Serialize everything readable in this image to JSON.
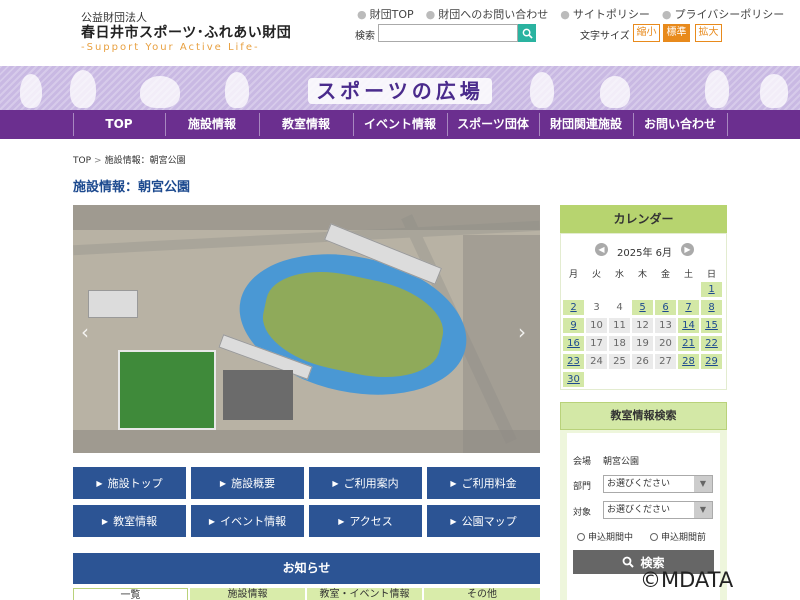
{
  "header": {
    "org_small": "公益財団法人",
    "org_name": "春日井市スポーツ･ふれあい財団",
    "tagline": "-Support Your Active Life-",
    "top_links": [
      "財団TOP",
      "財団へのお問い合わせ",
      "サイトポリシー",
      "プライバシーポリシー"
    ],
    "search_label": "検索",
    "search_value": "",
    "font_size_label": "文字サイズ",
    "font_sizes": [
      "縮小",
      "標準",
      "拡大"
    ],
    "active_font_size": "標準"
  },
  "banner": {
    "title": "スポーツの広場"
  },
  "nav": {
    "items": [
      "TOP",
      "施設情報",
      "教室情報",
      "イベント情報",
      "スポーツ団体",
      "財団関連施設",
      "お問い合わせ"
    ]
  },
  "breadcrumb": {
    "items": [
      "TOP",
      "施設情報：朝宮公園"
    ]
  },
  "page_title": "施設情報：朝宮公園",
  "carousel": {
    "prev": "‹",
    "next": "›"
  },
  "buttons": [
    "施設トップ",
    "施設概要",
    "ご利用案内",
    "ご利用料金",
    "教室情報",
    "イベント情報",
    "アクセス",
    "公園マップ"
  ],
  "news": {
    "title": "お知らせ",
    "tabs": [
      "一覧",
      "施設情報",
      "教室・イベント情報",
      "その他"
    ]
  },
  "calendar": {
    "title": "カレンダー",
    "month_label": "2025年 6月",
    "weekdays": [
      "月",
      "火",
      "水",
      "木",
      "金",
      "土",
      "日"
    ],
    "weeks": [
      [
        "",
        "",
        "",
        "",
        "",
        "",
        "1"
      ],
      [
        "2",
        "3",
        "4",
        "5",
        "6",
        "7",
        "8"
      ],
      [
        "9",
        "10",
        "11",
        "12",
        "13",
        "14",
        "15"
      ],
      [
        "16",
        "17",
        "18",
        "19",
        "20",
        "21",
        "22"
      ],
      [
        "23",
        "24",
        "25",
        "26",
        "27",
        "28",
        "29"
      ],
      [
        "30",
        "",
        "",
        "",
        "",
        "",
        ""
      ]
    ],
    "open_days": [
      "1",
      "2",
      "5",
      "6",
      "7",
      "8",
      "9",
      "14",
      "15",
      "16",
      "21",
      "22",
      "23",
      "28",
      "29",
      "30"
    ],
    "white_days": [
      "3",
      "4"
    ]
  },
  "class_search": {
    "title": "教室情報検索",
    "venue_label": "会場",
    "venue_value": "朝宮公園",
    "dept_label": "部門",
    "dept_value": "お選びください",
    "target_label": "対象",
    "target_value": "お選びください",
    "radio_1": "申込期間中",
    "radio_2": "申込期間前",
    "search_button": "検索"
  },
  "copyright": "©MDATA",
  "colors": {
    "nav": "#6b2f8f",
    "button": "#2c5494",
    "green": "#d3e8a6",
    "orange": "#e88a1c"
  }
}
